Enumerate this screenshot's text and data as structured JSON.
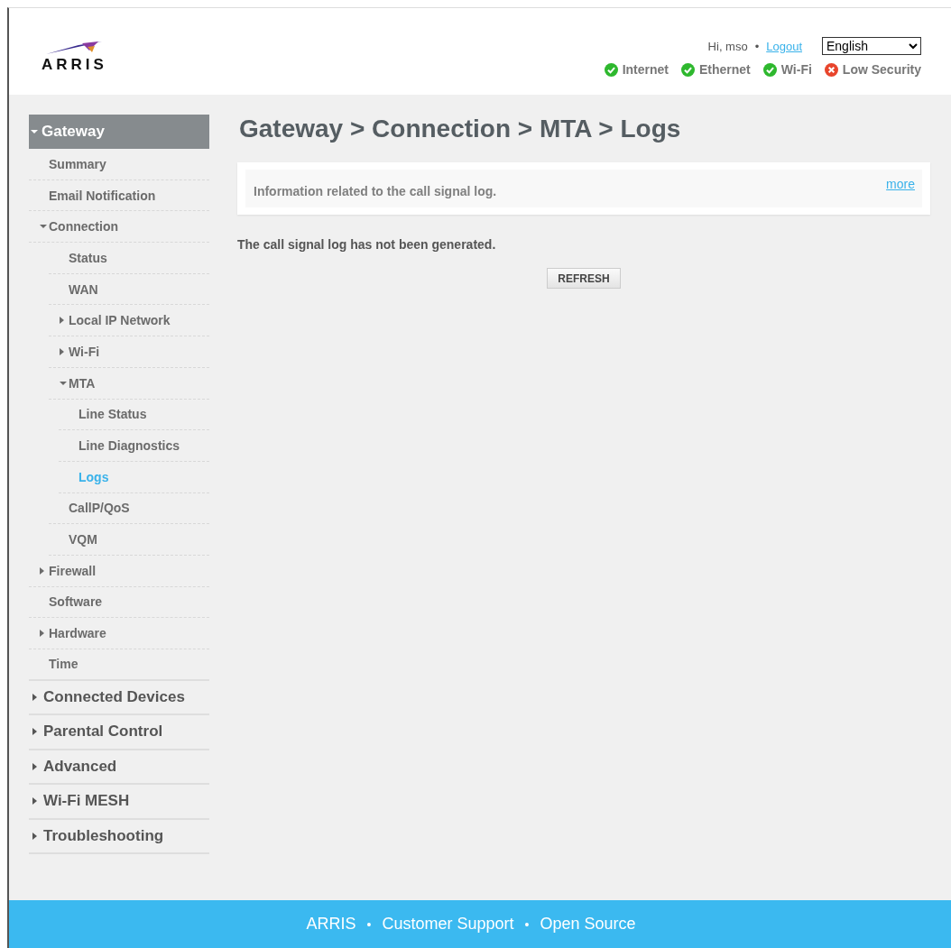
{
  "header": {
    "logo": "ARRIS",
    "greeting": "Hi, mso",
    "separator": "•",
    "logout": "Logout",
    "language": "English",
    "status": [
      {
        "label": "Internet",
        "ok": true
      },
      {
        "label": "Ethernet",
        "ok": true
      },
      {
        "label": "Wi-Fi",
        "ok": true
      },
      {
        "label": "Low Security",
        "ok": false
      }
    ]
  },
  "sidebar": {
    "items": [
      {
        "label": "Gateway",
        "expanded": true,
        "selected": false,
        "children": [
          {
            "label": "Summary",
            "selected": false
          },
          {
            "label": "Email Notification",
            "selected": false
          },
          {
            "label": "Connection",
            "expanded": true,
            "selected": false,
            "children": [
              {
                "label": "Status",
                "selected": false
              },
              {
                "label": "WAN",
                "selected": false
              },
              {
                "label": "Local IP Network",
                "expanded": false,
                "selected": false
              },
              {
                "label": "Wi-Fi",
                "expanded": false,
                "selected": false
              },
              {
                "label": "MTA",
                "expanded": true,
                "selected": false,
                "children": [
                  {
                    "label": "Line Status",
                    "selected": false
                  },
                  {
                    "label": "Line Diagnostics",
                    "selected": false
                  },
                  {
                    "label": "Logs",
                    "selected": true
                  }
                ]
              },
              {
                "label": "CallP/QoS",
                "selected": false
              },
              {
                "label": "VQM",
                "selected": false
              }
            ]
          },
          {
            "label": "Firewall",
            "expanded": false,
            "selected": false
          },
          {
            "label": "Software",
            "selected": false
          },
          {
            "label": "Hardware",
            "expanded": false,
            "selected": false
          },
          {
            "label": "Time",
            "selected": false
          }
        ]
      },
      {
        "label": "Connected Devices",
        "expanded": false,
        "selected": false
      },
      {
        "label": "Parental Control",
        "expanded": false,
        "selected": false
      },
      {
        "label": "Advanced",
        "expanded": false,
        "selected": false
      },
      {
        "label": "Wi-Fi MESH",
        "expanded": false,
        "selected": false
      },
      {
        "label": "Troubleshooting",
        "expanded": false,
        "selected": false
      }
    ]
  },
  "page": {
    "title": "Gateway > Connection > MTA > Logs",
    "info": "Information related to the call signal log.",
    "more": "more",
    "message": "The call signal log has not been generated.",
    "refresh": "REFRESH"
  },
  "footer": {
    "items": [
      {
        "kind": "link",
        "text": "ARRIS"
      },
      {
        "kind": "separator",
        "text": "•"
      },
      {
        "kind": "link",
        "text": "Customer Support"
      },
      {
        "kind": "separator",
        "text": "•"
      },
      {
        "kind": "link",
        "text": "Open Source"
      }
    ]
  }
}
